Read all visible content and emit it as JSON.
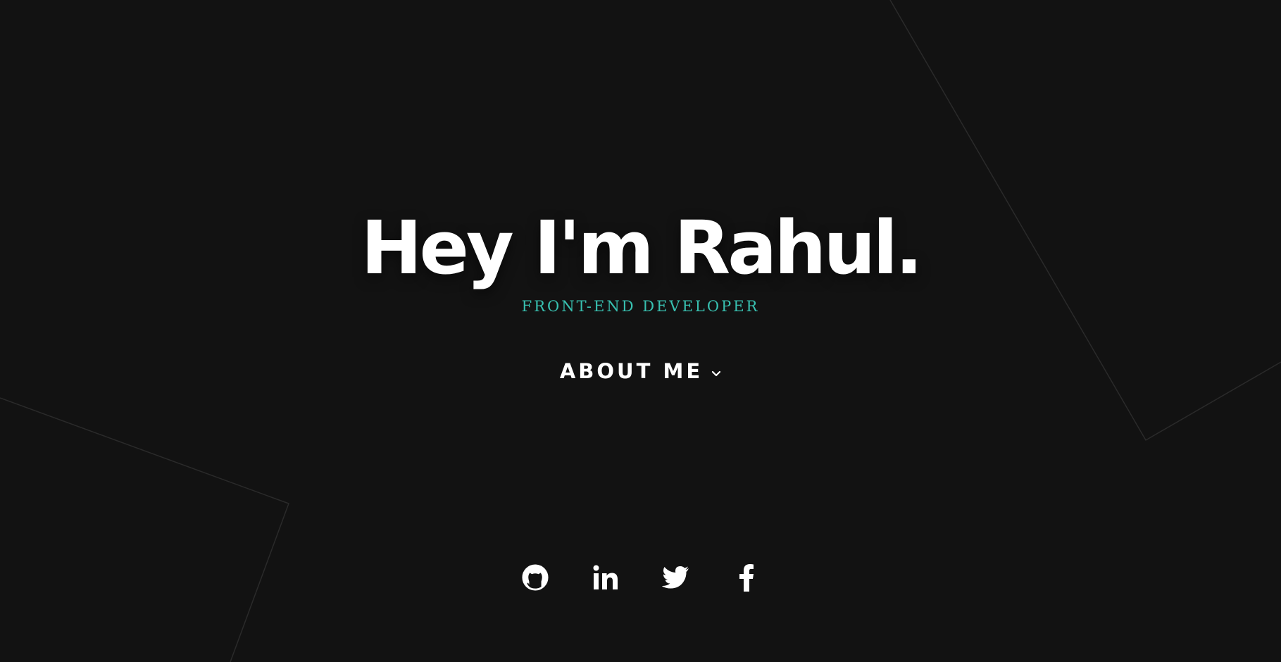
{
  "hero": {
    "title": "Hey I'm Rahul.",
    "subtitle": "FRONT-END DEVELOPER",
    "cta_label": "ABOUT ME",
    "cta_icon": "chevron-down-icon"
  },
  "socials": [
    {
      "icon": "github-icon"
    },
    {
      "icon": "linkedin-icon"
    },
    {
      "icon": "twitter-icon"
    },
    {
      "icon": "facebook-icon"
    }
  ],
  "colors": {
    "background": "#121212",
    "text": "#ffffff",
    "accent": "#38c0b0",
    "decor_lines": "#2a2a2a"
  }
}
